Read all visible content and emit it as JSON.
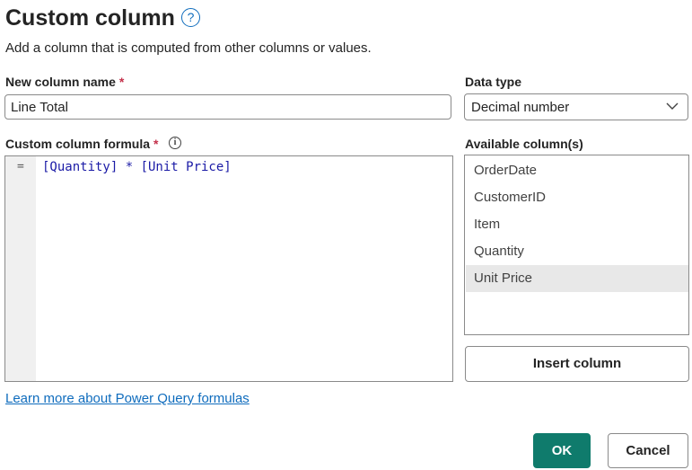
{
  "dialog": {
    "title": "Custom column",
    "help_icon": "question-circle-icon",
    "subtitle": "Add a column that is computed from other columns or values."
  },
  "column_name": {
    "label": "New column name",
    "required_mark": "*",
    "value": "Line Total"
  },
  "data_type": {
    "label": "Data type",
    "selected": "Decimal number",
    "icon": "chevron-down-icon"
  },
  "formula": {
    "label": "Custom column formula",
    "required_mark": "*",
    "info_icon": "info-icon",
    "gutter_symbol": "=",
    "code": "[Quantity] * [Unit Price]"
  },
  "available_columns": {
    "label": "Available column(s)",
    "items": [
      "OrderDate",
      "CustomerID",
      "Item",
      "Quantity",
      "Unit Price"
    ],
    "selected_item": "Unit Price"
  },
  "buttons": {
    "insert_column": "Insert column",
    "ok": "OK",
    "cancel": "Cancel"
  },
  "link": {
    "text": "Learn more about Power Query formulas"
  },
  "colors": {
    "accent": "#0f7b6c",
    "link": "#0f6cbd",
    "required": "#c4314b",
    "selected_row": "#e8e8e8"
  }
}
